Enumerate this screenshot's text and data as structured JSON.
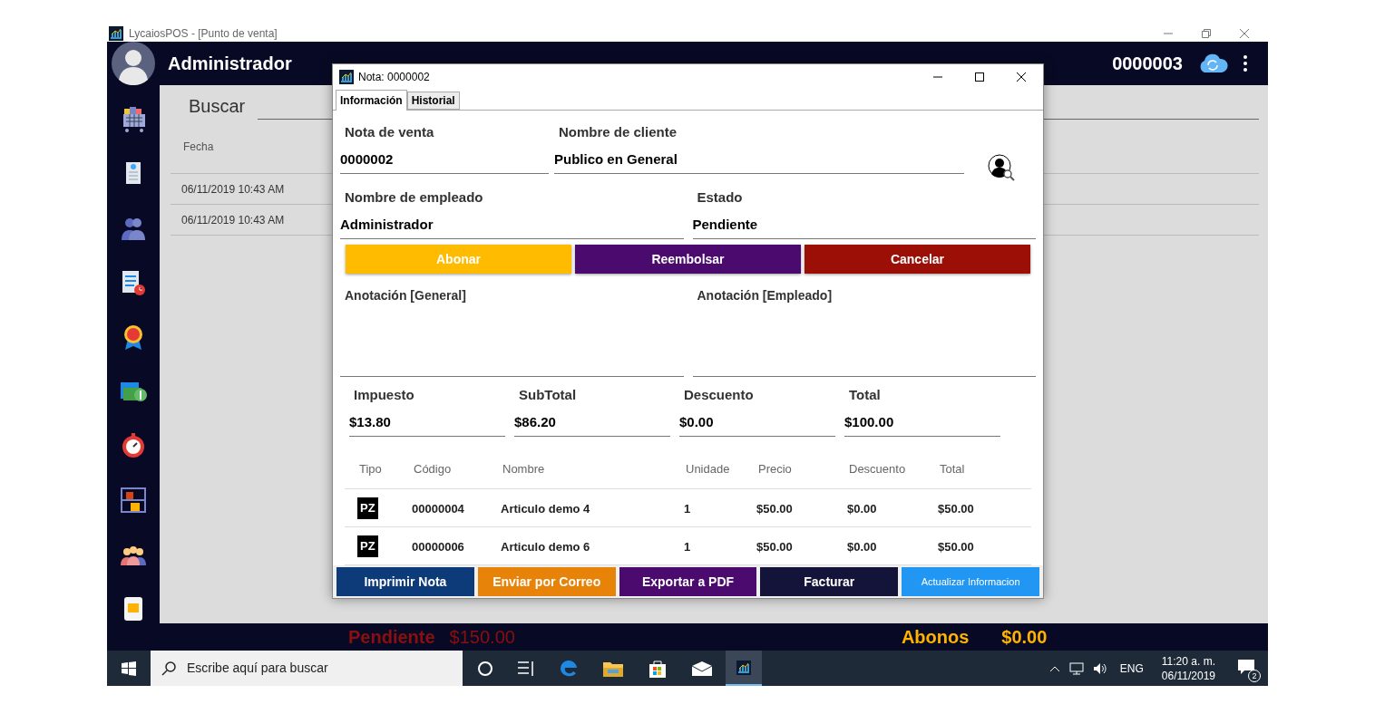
{
  "app": {
    "title": "LycaiosPOS - [Punto de venta]",
    "user_name": "Administrador",
    "note_number": "0000003"
  },
  "list": {
    "search_label": "Buscar",
    "columns": [
      "Fecha"
    ],
    "rows": [
      "06/11/2019 10:43 AM",
      "06/11/2019 10:43 AM"
    ]
  },
  "footer": {
    "pending_label": "Pendiente",
    "pending_value": "$150.00",
    "abonos_label": "Abonos",
    "abonos_value": "$0.00"
  },
  "taskbar": {
    "search_placeholder": "Escribe aquí para buscar",
    "language": "ENG",
    "time": "11:20 a. m.",
    "date": "06/11/2019",
    "notifications": "2"
  },
  "dialog": {
    "title": "Nota: 0000002",
    "tabs": [
      {
        "label": "Información",
        "selected": true
      },
      {
        "label": "Historial",
        "selected": false
      }
    ],
    "sale_note": {
      "label": "Nota de venta",
      "value": "0000002"
    },
    "customer": {
      "label": "Nombre de cliente",
      "value": "Publico en General"
    },
    "employee": {
      "label": "Nombre de empleado",
      "value": "Administrador"
    },
    "status": {
      "label": "Estado",
      "value": "Pendiente"
    },
    "actions": [
      {
        "label": "Abonar",
        "color": "#ffbb00"
      },
      {
        "label": "Reembolsar",
        "color": "#4a0a6e"
      },
      {
        "label": "Cancelar",
        "color": "#9b0f06"
      }
    ],
    "annotations": [
      "Anotación [General]",
      "Anotación [Empleado]"
    ],
    "totals": [
      {
        "label": "Impuesto",
        "value": "$13.80"
      },
      {
        "label": "SubTotal",
        "value": "$86.20"
      },
      {
        "label": "Descuento",
        "value": "$0.00"
      },
      {
        "label": "Total",
        "value": "$100.00"
      }
    ],
    "table": {
      "columns": [
        "Tipo",
        "Código",
        "Nombre",
        "Unidade",
        "Precio",
        "Descuento",
        "Total"
      ],
      "rows": [
        [
          "PZ",
          "00000004",
          "Articulo demo 4",
          "1",
          "$50.00",
          "$0.00",
          "$50.00"
        ],
        [
          "PZ",
          "00000006",
          "Articulo demo 6",
          "1",
          "$50.00",
          "$0.00",
          "$50.00"
        ]
      ]
    },
    "bottom_buttons": [
      {
        "label": "Imprimir Nota",
        "color": "#0d3b7a"
      },
      {
        "label": "Enviar por Correo",
        "color": "#e8830a"
      },
      {
        "label": "Exportar a PDF",
        "color": "#4a0a6e"
      },
      {
        "label": "Facturar",
        "color": "#14143a"
      },
      {
        "label": "Actualizar Informacion",
        "color": "#2196f3"
      }
    ]
  }
}
